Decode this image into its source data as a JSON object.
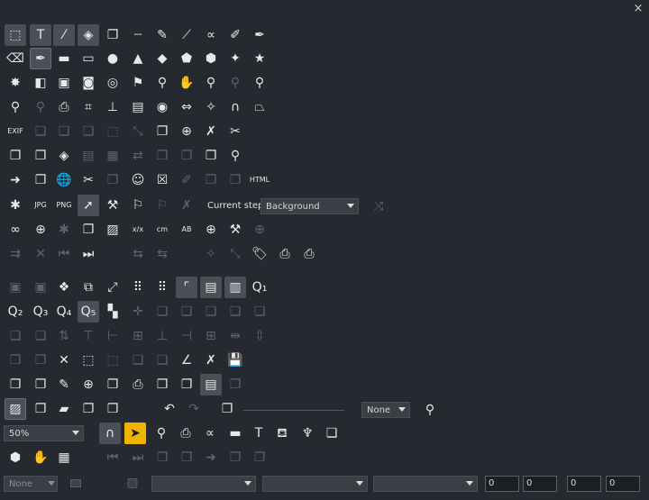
{
  "window": {
    "close_glyph": "×"
  },
  "rows": [
    [
      {
        "name": "select-object-icon",
        "glyph": "⬚",
        "state": "pressed"
      },
      {
        "name": "text-tool-icon",
        "glyph": "T",
        "state": "pressed"
      },
      {
        "name": "pick-color-icon",
        "glyph": "⁄",
        "state": "pressed"
      },
      {
        "name": "edit-vector-icon",
        "glyph": "◈",
        "state": "pressed"
      },
      {
        "name": "copy-objects-icon",
        "glyph": "❐",
        "state": "on"
      },
      {
        "name": "ruler-icon",
        "glyph": "┈",
        "state": "on"
      },
      {
        "name": "pencil-icon",
        "glyph": "✎",
        "state": "on"
      },
      {
        "name": "line-tool-icon",
        "glyph": "⟋",
        "state": "on"
      },
      {
        "name": "curve-icon",
        "glyph": "∝",
        "state": "on"
      },
      {
        "name": "brush-icon",
        "glyph": "✐",
        "state": "on"
      },
      {
        "name": "fx-brush-icon",
        "glyph": "✒",
        "state": "on"
      }
    ],
    [
      {
        "name": "eraser-icon",
        "glyph": "⌫",
        "state": "on"
      },
      {
        "name": "pen-tool-icon",
        "glyph": "✒",
        "state": "framed"
      },
      {
        "name": "rectangle-icon",
        "glyph": "▬",
        "state": "on"
      },
      {
        "name": "rounded-rectangle-icon",
        "glyph": "▭",
        "state": "on"
      },
      {
        "name": "circle-icon",
        "glyph": "●",
        "state": "on"
      },
      {
        "name": "triangle-icon",
        "glyph": "▲",
        "state": "on"
      },
      {
        "name": "diamond-icon",
        "glyph": "◆",
        "state": "on"
      },
      {
        "name": "pentagon-icon",
        "glyph": "⬟",
        "state": "on"
      },
      {
        "name": "hexagon-icon",
        "glyph": "⬢",
        "state": "on"
      },
      {
        "name": "four-point-star-icon",
        "glyph": "✦",
        "state": "on"
      },
      {
        "name": "star-icon",
        "glyph": "★",
        "state": "on"
      }
    ],
    [
      {
        "name": "burst-icon",
        "glyph": "✸",
        "state": "on"
      },
      {
        "name": "shape-combine-icon",
        "glyph": "◧",
        "state": "on"
      },
      {
        "name": "frame-icon",
        "glyph": "▣",
        "state": "on"
      },
      {
        "name": "merge-shapes-icon",
        "glyph": "◙",
        "state": "on"
      },
      {
        "name": "target-icon",
        "glyph": "◎",
        "state": "on"
      },
      {
        "name": "flag-icon",
        "glyph": "⚑",
        "state": "on"
      },
      {
        "name": "zoom-icon",
        "glyph": "⚲",
        "state": "on"
      },
      {
        "name": "pan-hand-icon",
        "glyph": "✋",
        "state": "on"
      },
      {
        "name": "zoom-100-icon",
        "glyph": "⚲",
        "state": "on"
      },
      {
        "name": "zoom-fit-icon",
        "glyph": "⚲",
        "state": "off"
      },
      {
        "name": "zoom-object-icon",
        "glyph": "⚲",
        "state": "on"
      }
    ],
    [
      {
        "name": "zoom-page-icon",
        "glyph": "⚲",
        "state": "on"
      },
      {
        "name": "zoom-selection-icon",
        "glyph": "⚲",
        "state": "off"
      },
      {
        "name": "camera-icon",
        "glyph": "⎙",
        "state": "on"
      },
      {
        "name": "crop-icon",
        "glyph": "⌗",
        "state": "on"
      },
      {
        "name": "stamp-icon",
        "glyph": "⊥",
        "state": "on"
      },
      {
        "name": "hatch-icon",
        "glyph": "▤",
        "state": "on"
      },
      {
        "name": "eye-icon",
        "glyph": "◉",
        "state": "on"
      },
      {
        "name": "fit-width-icon",
        "glyph": "⇔",
        "state": "on"
      },
      {
        "name": "auto-adjust-icon",
        "glyph": "✧",
        "state": "on"
      },
      {
        "name": "headphones-icon",
        "glyph": "∩",
        "state": "on"
      },
      {
        "name": "perspective-icon",
        "glyph": "⏢",
        "state": "on"
      }
    ],
    [
      {
        "name": "exif-icon",
        "glyph": "EXIF",
        "state": "on",
        "small": true
      },
      {
        "name": "layer-back-icon",
        "glyph": "❏",
        "state": "off"
      },
      {
        "name": "layer-front-icon",
        "glyph": "❏",
        "state": "off"
      },
      {
        "name": "layer-stack-icon",
        "glyph": "❏",
        "state": "off"
      },
      {
        "name": "select-area-icon",
        "glyph": "⬚",
        "state": "off"
      },
      {
        "name": "resize-icon",
        "glyph": "⤡",
        "state": "off"
      },
      {
        "name": "document-copy-icon",
        "glyph": "❐",
        "state": "on"
      },
      {
        "name": "document-add-icon",
        "glyph": "⊕",
        "state": "on"
      },
      {
        "name": "document-delete-icon",
        "glyph": "✗",
        "state": "on"
      },
      {
        "name": "scissors-icon",
        "glyph": "✂",
        "state": "on"
      }
    ],
    [
      {
        "name": "page-list-icon",
        "glyph": "❐",
        "state": "on"
      },
      {
        "name": "page-copy-icon",
        "glyph": "❐",
        "state": "on"
      },
      {
        "name": "page-tag-icon",
        "glyph": "◈",
        "state": "on"
      },
      {
        "name": "page-lines-icon",
        "glyph": "▤",
        "state": "off"
      },
      {
        "name": "page-grid-icon",
        "glyph": "▦",
        "state": "off"
      },
      {
        "name": "page-move-icon",
        "glyph": "⇄",
        "state": "off"
      },
      {
        "name": "page-text-icon",
        "glyph": "❐",
        "state": "off"
      },
      {
        "name": "page-export-icon",
        "glyph": "❐",
        "state": "off"
      },
      {
        "name": "folder-stack-icon",
        "glyph": "❐",
        "state": "on"
      },
      {
        "name": "user-search-icon",
        "glyph": "⚲",
        "state": "on"
      }
    ],
    [
      {
        "name": "doc-arrow-icon",
        "glyph": "➜",
        "state": "on"
      },
      {
        "name": "doc-forward-icon",
        "glyph": "❐",
        "state": "on"
      },
      {
        "name": "web-page-icon",
        "glyph": "🌐",
        "state": "on"
      },
      {
        "name": "doc-cut-icon",
        "glyph": "✂",
        "state": "on"
      },
      {
        "name": "doc-send-icon",
        "glyph": "❐",
        "state": "off"
      },
      {
        "name": "doc-people-icon",
        "glyph": "☺",
        "state": "on"
      },
      {
        "name": "doc-close-icon",
        "glyph": "☒",
        "state": "on"
      },
      {
        "name": "doc-paint-icon",
        "glyph": "✐",
        "state": "off"
      },
      {
        "name": "doc-blank-icon",
        "glyph": "❐",
        "state": "off"
      },
      {
        "name": "doc-print-icon",
        "glyph": "❐",
        "state": "off"
      },
      {
        "name": "html-icon",
        "glyph": "HTML",
        "state": "on",
        "small": true
      }
    ],
    [
      {
        "name": "wand-icon",
        "glyph": "✱",
        "state": "on"
      },
      {
        "name": "jpg-icon",
        "glyph": "JPG",
        "state": "on",
        "small": true
      },
      {
        "name": "png-icon",
        "glyph": "PNG",
        "state": "on",
        "small": true
      },
      {
        "name": "pointer-step-icon",
        "glyph": "➚",
        "state": "pressed"
      },
      {
        "name": "wrench-small-icon",
        "glyph": "⚒",
        "state": "on"
      },
      {
        "name": "pin-icon",
        "glyph": "⚐",
        "state": "on"
      },
      {
        "name": "pin-alt-icon",
        "glyph": "⚐",
        "state": "off"
      },
      {
        "name": "fx-disabled-icon",
        "glyph": "✗",
        "state": "off"
      }
    ],
    [
      {
        "name": "link-icon",
        "glyph": "∞",
        "state": "on"
      },
      {
        "name": "globe-icon",
        "glyph": "⊕",
        "state": "on"
      },
      {
        "name": "antenna-icon",
        "glyph": "✱",
        "state": "off"
      },
      {
        "name": "layer-export-icon",
        "glyph": "❐",
        "state": "on"
      },
      {
        "name": "image-icon",
        "glyph": "▨",
        "state": "on"
      },
      {
        "name": "ratio-icon",
        "glyph": "x/x",
        "state": "on",
        "small": true
      },
      {
        "name": "cm-icon",
        "glyph": "cm",
        "state": "on",
        "small": true
      },
      {
        "name": "ab-icon",
        "glyph": "AB",
        "state": "on",
        "small": true
      },
      {
        "name": "globe-settings-icon",
        "glyph": "⊕",
        "state": "on"
      },
      {
        "name": "wrench-icon",
        "glyph": "⚒",
        "state": "on"
      },
      {
        "name": "add-disabled-icon",
        "glyph": "⊕",
        "state": "off"
      }
    ],
    [
      {
        "name": "split-icon",
        "glyph": "⇉",
        "state": "off"
      },
      {
        "name": "cross-icon",
        "glyph": "✕",
        "state": "off"
      },
      {
        "name": "skip-back-icon",
        "glyph": "⏮",
        "state": "off"
      },
      {
        "name": "play-next-icon",
        "glyph": "⏭",
        "state": "on"
      },
      {
        "name": "blank-1-icon",
        "glyph": "",
        "state": "off"
      },
      {
        "name": "transform-a-icon",
        "glyph": "⇆",
        "state": "off"
      },
      {
        "name": "transform-b-icon",
        "glyph": "⇆",
        "state": "off"
      },
      {
        "name": "blank-2-icon",
        "glyph": "",
        "state": "off"
      },
      {
        "name": "magic-disabled-icon",
        "glyph": "✧",
        "state": "off"
      },
      {
        "name": "resize-disabled-icon",
        "glyph": "⤡",
        "state": "off"
      },
      {
        "name": "tag-icon",
        "glyph": "🏷",
        "state": "on"
      },
      {
        "name": "printer-icon",
        "glyph": "⎙",
        "state": "on"
      },
      {
        "name": "printer-alt-icon",
        "glyph": "⎙",
        "state": "on"
      }
    ],
    [
      {
        "name": "group-icon",
        "glyph": "▣",
        "state": "off"
      },
      {
        "name": "ungroup-icon",
        "glyph": "▣",
        "state": "off"
      },
      {
        "name": "puzzle-icon",
        "glyph": "❖",
        "state": "on"
      },
      {
        "name": "window-link-icon",
        "glyph": "⧉",
        "state": "on"
      },
      {
        "name": "expand-icon",
        "glyph": "⤢",
        "state": "on"
      },
      {
        "name": "dots-grid-icon",
        "glyph": "⠿",
        "state": "on"
      },
      {
        "name": "dots-arrow-icon",
        "glyph": "⠿",
        "state": "on"
      },
      {
        "name": "corner-icon",
        "glyph": "⌜",
        "state": "pressed"
      },
      {
        "name": "table-row-icon",
        "glyph": "▤",
        "state": "pressed"
      },
      {
        "name": "table-col-icon",
        "glyph": "▥",
        "state": "pressed"
      },
      {
        "name": "q1-icon",
        "glyph": "Q₁",
        "state": "on"
      }
    ],
    [
      {
        "name": "q2-icon",
        "glyph": "Q₂",
        "state": "on"
      },
      {
        "name": "q3-icon",
        "glyph": "Q₃",
        "state": "on"
      },
      {
        "name": "q4-icon",
        "glyph": "Q₄",
        "state": "on"
      },
      {
        "name": "q5-icon",
        "glyph": "Q₅",
        "state": "pressed"
      },
      {
        "name": "blocks-icon",
        "glyph": "▚",
        "state": "on"
      },
      {
        "name": "move-cross-icon",
        "glyph": "✛",
        "state": "off"
      },
      {
        "name": "layer-up-icon",
        "glyph": "❏",
        "state": "off"
      },
      {
        "name": "layer-down-icon",
        "glyph": "❏",
        "state": "off"
      },
      {
        "name": "layer-top-icon",
        "glyph": "❏",
        "state": "off"
      },
      {
        "name": "layer-bottom-icon",
        "glyph": "❏",
        "state": "off"
      },
      {
        "name": "layer-inside-icon",
        "glyph": "❏",
        "state": "off"
      }
    ],
    [
      {
        "name": "align-group-icon",
        "glyph": "❏",
        "state": "off"
      },
      {
        "name": "align-inner-icon",
        "glyph": "❏",
        "state": "off"
      },
      {
        "name": "flip-icon",
        "glyph": "⇅",
        "state": "off"
      },
      {
        "name": "align-top-icon",
        "glyph": "⊤",
        "state": "off"
      },
      {
        "name": "align-left-icon",
        "glyph": "⊢",
        "state": "off"
      },
      {
        "name": "align-hcenter-icon",
        "glyph": "⊞",
        "state": "off"
      },
      {
        "name": "align-bottom-icon",
        "glyph": "⊥",
        "state": "off"
      },
      {
        "name": "align-right-icon",
        "glyph": "⊣",
        "state": "off"
      },
      {
        "name": "align-vcenter-icon",
        "glyph": "⊞",
        "state": "off"
      },
      {
        "name": "distribute-h-icon",
        "glyph": "⇹",
        "state": "off"
      },
      {
        "name": "distribute-v-icon",
        "glyph": "⇳",
        "state": "off"
      }
    ],
    [
      {
        "name": "duplicate-icon",
        "glyph": "❐",
        "state": "off"
      },
      {
        "name": "stack-objects-icon",
        "glyph": "❐",
        "state": "off"
      },
      {
        "name": "delete-x-icon",
        "glyph": "✕",
        "state": "on"
      },
      {
        "name": "selection-frame-icon",
        "glyph": "⬚",
        "state": "on"
      },
      {
        "name": "edit-points-icon",
        "glyph": "⬚",
        "state": "off"
      },
      {
        "name": "group-objects-icon",
        "glyph": "❏",
        "state": "off"
      },
      {
        "name": "node-edit-icon",
        "glyph": "❏",
        "state": "off"
      },
      {
        "name": "angle-icon",
        "glyph": "∠",
        "state": "on"
      },
      {
        "name": "delete-doc-icon",
        "glyph": "✗",
        "state": "on"
      },
      {
        "name": "save-icon",
        "glyph": "💾",
        "state": "on"
      }
    ],
    [
      {
        "name": "pages-icon",
        "glyph": "❐",
        "state": "on"
      },
      {
        "name": "pages-copy-icon",
        "glyph": "❐",
        "state": "on"
      },
      {
        "name": "pages-edit-icon",
        "glyph": "✎",
        "state": "on"
      },
      {
        "name": "pages-web-icon",
        "glyph": "⊕",
        "state": "on"
      },
      {
        "name": "pages-send-icon",
        "glyph": "❐",
        "state": "on"
      },
      {
        "name": "pages-print-icon",
        "glyph": "⎙",
        "state": "on"
      },
      {
        "name": "pages-move-icon",
        "glyph": "❐",
        "state": "on"
      },
      {
        "name": "pages-link-icon",
        "glyph": "❐",
        "state": "on"
      },
      {
        "name": "notes-icon",
        "glyph": "▤",
        "state": "pressed"
      },
      {
        "name": "pages-disabled-icon",
        "glyph": "❐",
        "state": "off"
      }
    ],
    [
      {
        "name": "image-view-icon",
        "glyph": "▨",
        "state": "framed"
      },
      {
        "name": "new-doc-icon",
        "glyph": "❐",
        "state": "on"
      },
      {
        "name": "folder-icon",
        "glyph": "▰",
        "state": "on"
      },
      {
        "name": "doc-stack-icon",
        "glyph": "❐",
        "state": "on"
      },
      {
        "name": "clipboard-icon",
        "glyph": "❐",
        "state": "on"
      },
      {
        "name": "undo-icon",
        "glyph": "↶",
        "state": "on"
      },
      {
        "name": "redo-icon",
        "glyph": "↷",
        "state": "off"
      },
      {
        "name": "copy-style-icon",
        "glyph": "❐",
        "state": "on"
      }
    ],
    [
      {
        "name": "magnet-icon",
        "glyph": "∩",
        "state": "pressed"
      },
      {
        "name": "pointer-icon",
        "glyph": "➤",
        "state": "selected"
      },
      {
        "name": "lasso-icon",
        "glyph": "⚲",
        "state": "on"
      },
      {
        "name": "snapshot-icon",
        "glyph": "⎙",
        "state": "on"
      },
      {
        "name": "freehand-icon",
        "glyph": "∝",
        "state": "on"
      },
      {
        "name": "box-icon",
        "glyph": "▬",
        "state": "on"
      },
      {
        "name": "text-large-icon",
        "glyph": "T",
        "state": "on"
      },
      {
        "name": "paint-bucket-icon",
        "glyph": "⛾",
        "state": "on"
      },
      {
        "name": "goblet-icon",
        "glyph": "♆",
        "state": "on"
      },
      {
        "name": "layer-overlap-icon",
        "glyph": "❏",
        "state": "on"
      }
    ],
    [
      {
        "name": "cube-icon",
        "glyph": "⬢",
        "state": "on"
      },
      {
        "name": "hand-icon",
        "glyph": "✋",
        "state": "on"
      },
      {
        "name": "grid-table-icon",
        "glyph": "▦",
        "state": "on"
      },
      {
        "name": "blank-3-icon",
        "glyph": "",
        "state": "off"
      },
      {
        "name": "prev-icon",
        "glyph": "⏮",
        "state": "off"
      },
      {
        "name": "next-icon",
        "glyph": "⏭",
        "state": "off"
      },
      {
        "name": "prev-page-icon",
        "glyph": "❐",
        "state": "off"
      },
      {
        "name": "next-page-icon",
        "glyph": "❐",
        "state": "off"
      },
      {
        "name": "arrow-page-icon",
        "glyph": "➜",
        "state": "off"
      },
      {
        "name": "export-page-icon",
        "glyph": "❐",
        "state": "off"
      },
      {
        "name": "share-page-icon",
        "glyph": "❐",
        "state": "off"
      }
    ]
  ],
  "current_step": {
    "label": "Current step:",
    "value": "Background"
  },
  "none_combo": {
    "value": "None"
  },
  "zoom_combo": {
    "value": "50%"
  },
  "bottom": {
    "none_value": "None",
    "combo_a": "",
    "combo_b": "",
    "combo_c": "",
    "num1": "0",
    "num2": "0",
    "num3": "0",
    "num4": "0"
  }
}
